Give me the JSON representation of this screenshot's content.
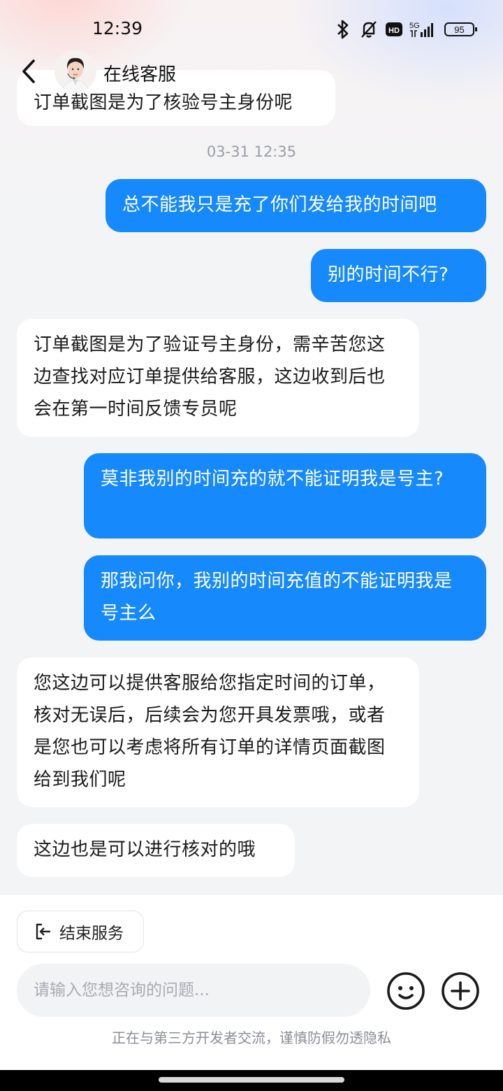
{
  "status": {
    "time": "12:39",
    "battery": "95",
    "network": "5G",
    "hd_badge": "HD",
    "icons": [
      "bluetooth-icon",
      "mute-bell-icon",
      "hd-icon",
      "signal-5g-icon",
      "battery-icon"
    ]
  },
  "header": {
    "title": "在线客服",
    "back_icon": "chevron-left-icon",
    "avatar": "agent-avatar"
  },
  "chat": {
    "partial_message": "订单截图是为了核验号主身份呢",
    "timestamp": "03-31 12:35",
    "messages": [
      {
        "from": "user",
        "text": "总不能我只是充了你们发给我的时间吧"
      },
      {
        "from": "user",
        "text": "别的时间不行?"
      },
      {
        "from": "agent",
        "text": "订单截图是为了验证号主身份，需辛苦您这边查找对应订单提供给客服，这边收到后也会在第一时间反馈专员呢"
      },
      {
        "from": "user",
        "text": "莫非我别的时间充的就不能证明我是号主?"
      },
      {
        "from": "user",
        "text": "那我问你，我别的时间充值的不能证明我是号主么"
      },
      {
        "from": "agent",
        "text": "您这边可以提供客服给您指定时间的订单，核对无误后，后续会为您开具发票哦，或者是您也可以考虑将所有订单的详情页面截图给到我们呢"
      },
      {
        "from": "agent",
        "text": "这边也是可以进行核对的哦"
      }
    ]
  },
  "bottom": {
    "end_service_label": "结束服务",
    "input_placeholder": "请输入您想咨询的问题...",
    "notice": "正在与第三方开发者交流，谨慎防假勿透隐私"
  },
  "colors": {
    "accent": "#1689fc",
    "agent_bubble": "#ffffff",
    "background": "#f3f4f6"
  }
}
